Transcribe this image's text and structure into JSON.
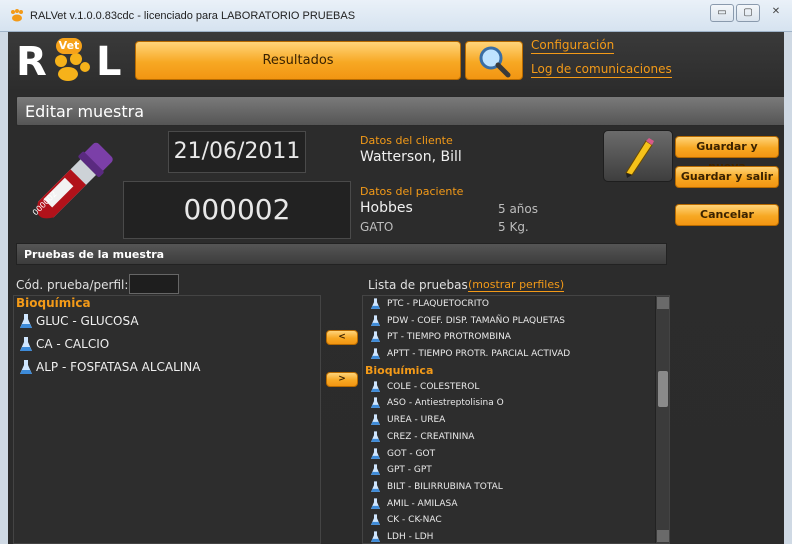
{
  "window": {
    "title": "RALVet v.1.0.0.83cdc - licenciado para LABORATORIO PRUEBAS"
  },
  "header": {
    "logo_left": "R",
    "logo_right": "L",
    "logo_badge": "Vet",
    "tab_label": "Resultados",
    "link_config": "Configuración",
    "link_log": "Log de comunicaciones"
  },
  "section": {
    "title": "Editar muestra"
  },
  "sample": {
    "date": "21/06/2011",
    "id": "000002",
    "tube_label": "000002"
  },
  "client": {
    "label": "Datos del cliente",
    "name": "Watterson, Bill"
  },
  "patient": {
    "label": "Datos del paciente",
    "name": "Hobbes",
    "age": "5 años",
    "species": "GATO",
    "weight": "5 Kg."
  },
  "actions": {
    "save_new": "Guardar y nueva",
    "save_exit": "Guardar y salir",
    "cancel": "Cancelar"
  },
  "tests": {
    "bar_title": "Pruebas de la muestra",
    "code_label": "Cód. prueba/perfil:",
    "list_label": "Lista de pruebas",
    "show_profiles": "(mostrar perfiles)",
    "btn_remove": "<",
    "btn_add": ">",
    "selected_group": "Bioquímica",
    "selected": [
      "GLUC - GLUCOSA",
      "CA - CALCIO",
      "ALP - FOSFATASA ALCALINA"
    ],
    "available_top": [
      "PTC - PLAQUETOCRITO",
      "PDW - COEF. DISP. TAMAÑO PLAQUETAS",
      "PT - TIEMPO PROTROMBINA",
      "APTT - TIEMPO PROTR. PARCIAL ACTIVAD"
    ],
    "available_group": "Bioquímica",
    "available_bio": [
      "COLE - COLESTEROL",
      "ASO - Antiestreptolisina O",
      "UREA - UREA",
      "CREZ - CREATININA",
      "GOT - GOT",
      "GPT - GPT",
      "BILT - BILIRRUBINA TOTAL",
      "AMIL - AMILASA",
      "CK - CK-NAC",
      "LDH - LDH"
    ]
  },
  "colors": {
    "accent": "#f39a18",
    "background": "#2b2b2b"
  }
}
